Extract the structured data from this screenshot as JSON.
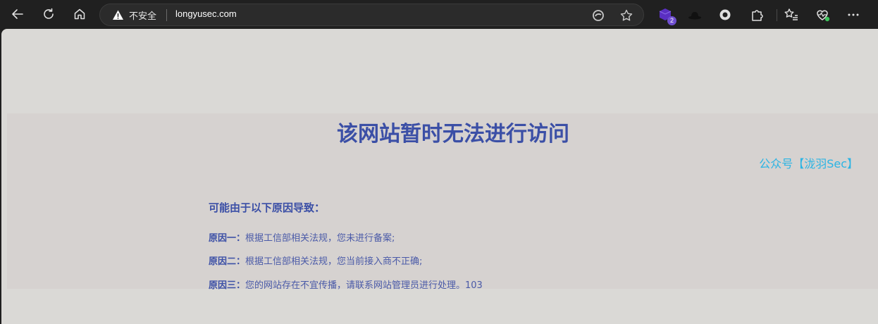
{
  "browser": {
    "security_label": "不安全",
    "url": "longyusec.com",
    "extension_badge": "2"
  },
  "page": {
    "title": "该网站暂时无法进行访问",
    "wechat_note": "公众号【泷羽Sec】",
    "reasons_title": "可能由于以下原因导致：",
    "reasons": [
      {
        "label": "原因一：",
        "text": "根据工信部相关法规，您未进行备案;"
      },
      {
        "label": "原因二：",
        "text": "根据工信部相关法规，您当前接入商不正确;"
      },
      {
        "label": "原因三：",
        "text": "您的网站存在不宜传播，请联系网站管理员进行处理。103"
      }
    ]
  },
  "colors": {
    "accent": "#3b4fa6",
    "link": "#2ab4e4",
    "page_bg": "#dad9d6",
    "panel_bg": "#d6d2d0"
  }
}
